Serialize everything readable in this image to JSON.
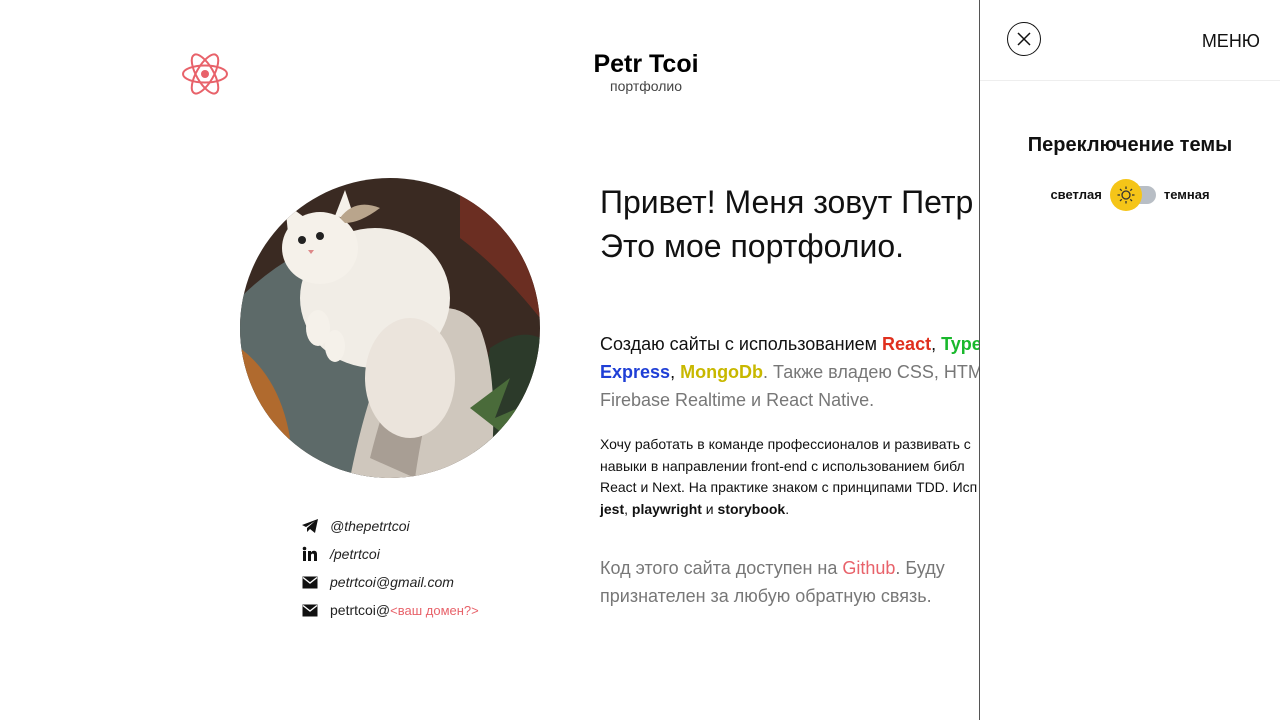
{
  "header": {
    "logo_icon": "react-atom-icon",
    "brand_name": "Petr Tcoi",
    "brand_sub": "портфолио"
  },
  "profile": {
    "photo_alt": "cat-photo"
  },
  "contacts": [
    {
      "icon": "telegram-icon",
      "text": "@thepetrtcoi"
    },
    {
      "icon": "linkedin-icon",
      "text": "/petrtcoi"
    },
    {
      "icon": "mail-icon",
      "text": "petrtcoi@gmail.com"
    },
    {
      "icon": "mail-icon",
      "text": "petrtcoi@",
      "accent": "<ваш домен?>"
    }
  ],
  "intro": {
    "hello_line1": "Привет! Меня зовут Петр",
    "hello_line2": "Это мое портфолио.",
    "skills_prefix": "Создаю сайты с использованием ",
    "skill_react": "React",
    "sep1": ", ",
    "skill_ts": "TypeS",
    "skill_express": "Express",
    "sep2": ", ",
    "skill_mongo": "MongoDb",
    "skills_rest": ". Также владею CSS, HTML,",
    "skills_line3": "Firebase Realtime и React Native.",
    "about_line1": "Хочу работать в команде профессионалов и развивать с",
    "about_line2": "навыки в направлении front-end с использованием библ",
    "about_line3": "React и Next. На практике знаком с принципами TDD. Исп",
    "about_jest": "jest",
    "about_sep1": ", ",
    "about_playwright": "playwright",
    "about_and": " и ",
    "about_storybook": "storybook",
    "about_end": ".",
    "repo_prefix": "Код этого сайта доступен на ",
    "repo_link": "Github",
    "repo_suffix": ". Буду признателен за любую обратную связь."
  },
  "menu": {
    "title": "МЕНЮ",
    "close_icon": "close-icon",
    "theme_title": "Переключение темы",
    "theme_light": "светлая",
    "theme_dark": "темная",
    "theme_selected": "светлая"
  },
  "colors": {
    "react": "#e0301e",
    "typescript": "#19b82c",
    "express": "#1f3fd6",
    "mongodb": "#c8b800",
    "accent": "#e8626a",
    "toggle_knob": "#f5c518"
  }
}
